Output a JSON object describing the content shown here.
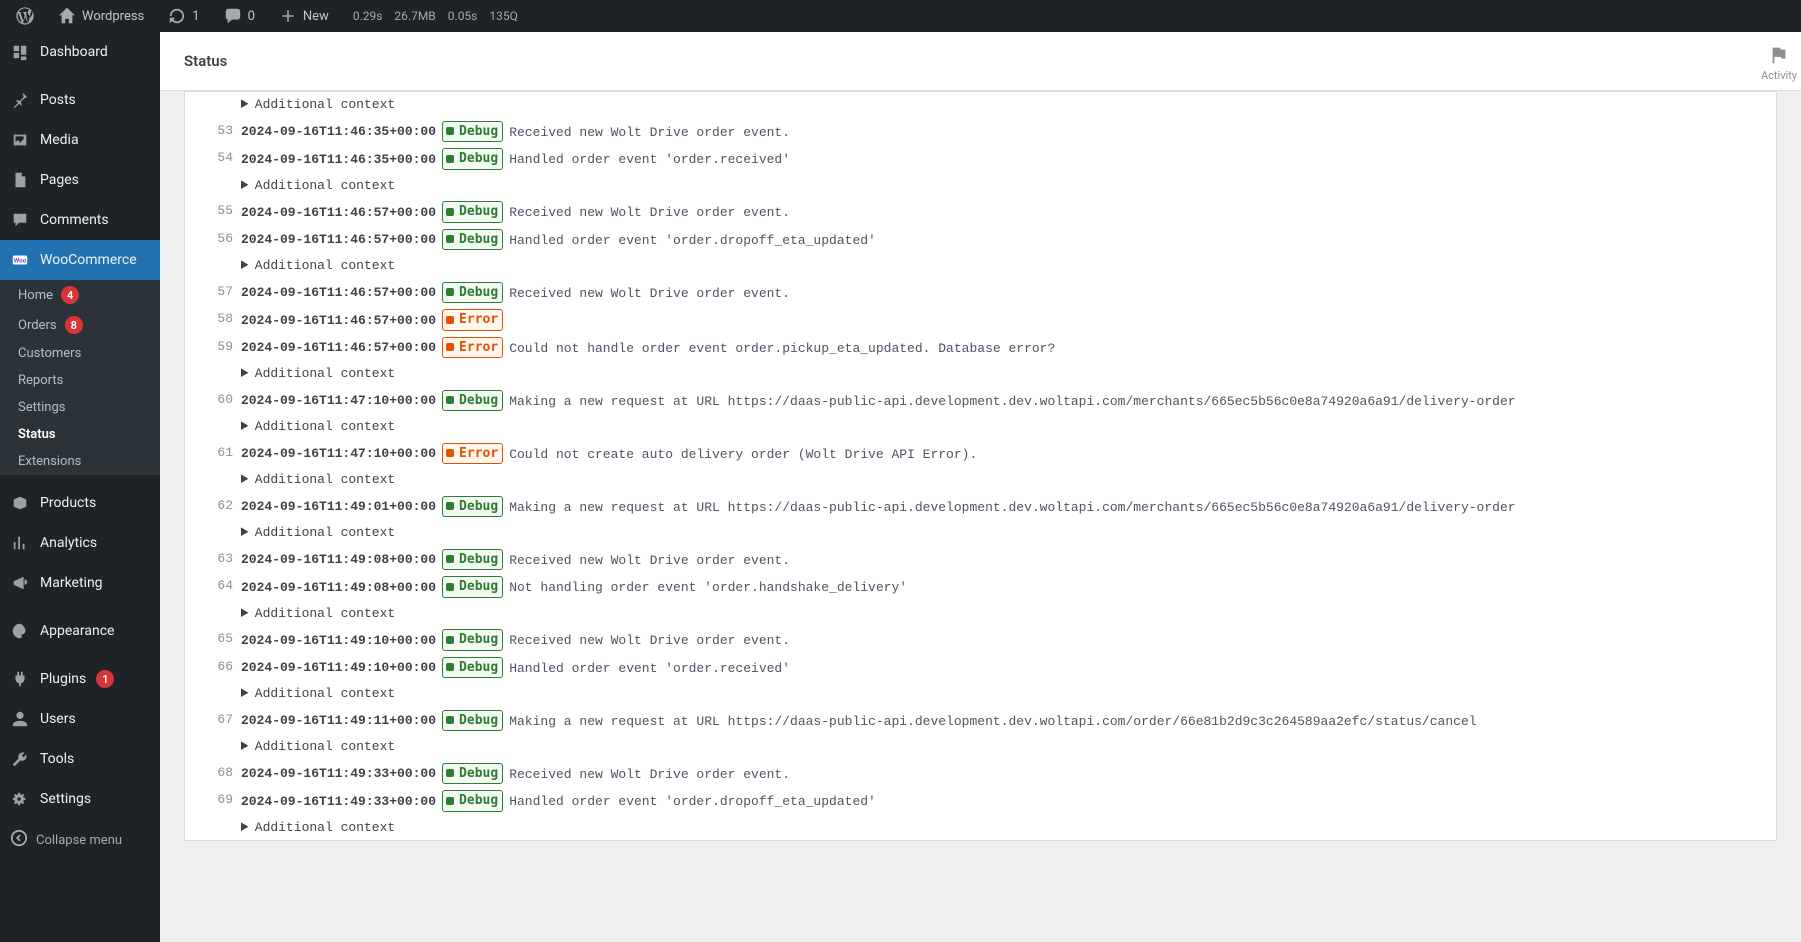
{
  "adminbar": {
    "site_name": "Wordpress",
    "updates_count": "1",
    "comments_count": "0",
    "new_label": "New",
    "metrics": {
      "time": "0.29s",
      "mem": "26.7MB",
      "db": "0.05s",
      "q": "135Q"
    }
  },
  "header": {
    "title": "Status",
    "activity_label": "Activity"
  },
  "sidebar": {
    "items": [
      {
        "label": "Dashboard",
        "icon": "dashboard"
      },
      {
        "label": "Posts",
        "icon": "pin"
      },
      {
        "label": "Media",
        "icon": "media"
      },
      {
        "label": "Pages",
        "icon": "page"
      },
      {
        "label": "Comments",
        "icon": "comment"
      },
      {
        "label": "WooCommerce",
        "icon": "woo",
        "active": true,
        "submenu": [
          {
            "label": "Home",
            "badge": "4"
          },
          {
            "label": "Orders",
            "badge": "8"
          },
          {
            "label": "Customers"
          },
          {
            "label": "Reports"
          },
          {
            "label": "Settings"
          },
          {
            "label": "Status",
            "current": true
          },
          {
            "label": "Extensions"
          }
        ]
      },
      {
        "label": "Products",
        "icon": "products"
      },
      {
        "label": "Analytics",
        "icon": "analytics"
      },
      {
        "label": "Marketing",
        "icon": "marketing"
      },
      {
        "label": "Appearance",
        "icon": "appearance"
      },
      {
        "label": "Plugins",
        "icon": "plugins",
        "badge": "1"
      },
      {
        "label": "Users",
        "icon": "users"
      },
      {
        "label": "Tools",
        "icon": "tools"
      },
      {
        "label": "Settings",
        "icon": "settings"
      }
    ],
    "collapse_label": "Collapse menu"
  },
  "log": {
    "additional_context_label": "Additional context",
    "entries": [
      {
        "context_before": true,
        "line": "53",
        "ts": "2024-09-16T11:46:35+00:00",
        "level": "Debug",
        "msg": "Received new Wolt Drive order event."
      },
      {
        "line": "54",
        "ts": "2024-09-16T11:46:35+00:00",
        "level": "Debug",
        "msg": "Handled order event 'order.received'",
        "context_after": true
      },
      {
        "line": "55",
        "ts": "2024-09-16T11:46:57+00:00",
        "level": "Debug",
        "msg": "Received new Wolt Drive order event."
      },
      {
        "line": "56",
        "ts": "2024-09-16T11:46:57+00:00",
        "level": "Debug",
        "msg": "Handled order event 'order.dropoff_eta_updated'",
        "context_after": true
      },
      {
        "line": "57",
        "ts": "2024-09-16T11:46:57+00:00",
        "level": "Debug",
        "msg": "Received new Wolt Drive order event."
      },
      {
        "line": "58",
        "ts": "2024-09-16T11:46:57+00:00",
        "level": "Error",
        "msg": ""
      },
      {
        "line": "59",
        "ts": "2024-09-16T11:46:57+00:00",
        "level": "Error",
        "msg": "Could not handle order event order.pickup_eta_updated. Database error?",
        "context_after": true
      },
      {
        "line": "60",
        "ts": "2024-09-16T11:47:10+00:00",
        "level": "Debug",
        "msg": "Making a new request at URL https://daas-public-api.development.dev.woltapi.com/merchants/665ec5b56c0e8a74920a6a91/delivery-order",
        "context_after": true
      },
      {
        "line": "61",
        "ts": "2024-09-16T11:47:10+00:00",
        "level": "Error",
        "msg": "Could not create auto delivery order (Wolt Drive API Error).",
        "context_after": true
      },
      {
        "line": "62",
        "ts": "2024-09-16T11:49:01+00:00",
        "level": "Debug",
        "msg": "Making a new request at URL https://daas-public-api.development.dev.woltapi.com/merchants/665ec5b56c0e8a74920a6a91/delivery-order",
        "context_after": true
      },
      {
        "line": "63",
        "ts": "2024-09-16T11:49:08+00:00",
        "level": "Debug",
        "msg": "Received new Wolt Drive order event."
      },
      {
        "line": "64",
        "ts": "2024-09-16T11:49:08+00:00",
        "level": "Debug",
        "msg": "Not handling order event 'order.handshake_delivery'",
        "context_after": true
      },
      {
        "line": "65",
        "ts": "2024-09-16T11:49:10+00:00",
        "level": "Debug",
        "msg": "Received new Wolt Drive order event."
      },
      {
        "line": "66",
        "ts": "2024-09-16T11:49:10+00:00",
        "level": "Debug",
        "msg": "Handled order event 'order.received'",
        "context_after": true
      },
      {
        "line": "67",
        "ts": "2024-09-16T11:49:11+00:00",
        "level": "Debug",
        "msg": "Making a new request at URL https://daas-public-api.development.dev.woltapi.com/order/66e81b2d9c3c264589aa2efc/status/cancel",
        "context_after": true
      },
      {
        "line": "68",
        "ts": "2024-09-16T11:49:33+00:00",
        "level": "Debug",
        "msg": "Received new Wolt Drive order event."
      },
      {
        "line": "69",
        "ts": "2024-09-16T11:49:33+00:00",
        "level": "Debug",
        "msg": "Handled order event 'order.dropoff_eta_updated'",
        "context_after": true
      }
    ]
  }
}
